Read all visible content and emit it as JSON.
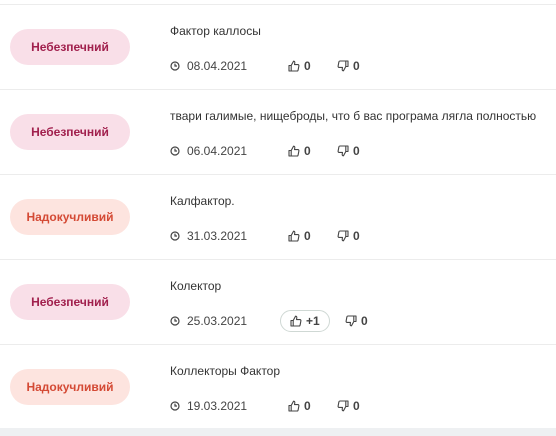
{
  "reviews": [
    {
      "badge": "Небезпечний",
      "type": "danger",
      "text": "Фактор каллосы",
      "date": "08.04.2021",
      "likes": "0",
      "dislikes": "0"
    },
    {
      "badge": "Небезпечний",
      "type": "danger",
      "text": "твари галимые, нищеброды, что б вас програма лягла полностью",
      "date": "06.04.2021",
      "likes": "0",
      "dislikes": "0"
    },
    {
      "badge": "Надокучливий",
      "type": "annoying",
      "text": "Калфактор.",
      "date": "31.03.2021",
      "likes": "0",
      "dislikes": "0"
    },
    {
      "badge": "Небезпечний",
      "type": "danger",
      "text": "Колектор",
      "date": "25.03.2021",
      "likes": "+1",
      "dislikes": "0"
    },
    {
      "badge": "Надокучливий",
      "type": "annoying",
      "text": "Коллекторы Фактор",
      "date": "19.03.2021",
      "likes": "0",
      "dislikes": "0"
    }
  ],
  "colors": {
    "danger_bg": "#f9dfe8",
    "danger_text": "#a1204d",
    "annoying_bg": "#fde4df",
    "annoying_text": "#d44a35"
  },
  "icons": {
    "date": "clock-icon",
    "like": "thumbs-up-icon",
    "dislike": "thumbs-down-icon"
  }
}
